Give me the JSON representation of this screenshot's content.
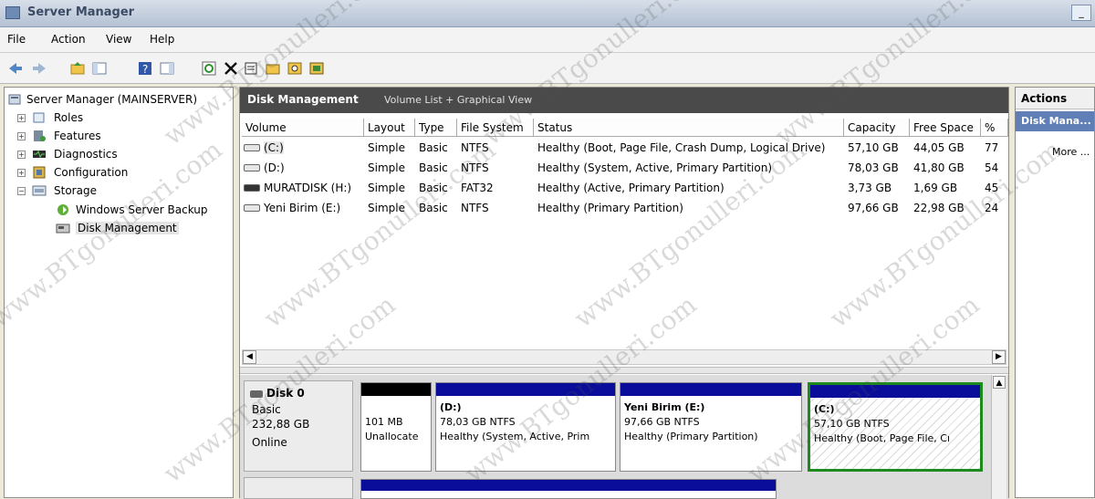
{
  "window": {
    "title": "Server Manager",
    "minimize_label": "_"
  },
  "menu": {
    "items": [
      "File",
      "Action",
      "View",
      "Help"
    ]
  },
  "tree": {
    "root": "Server Manager (MAINSERVER)",
    "items": [
      "Roles",
      "Features",
      "Diagnostics",
      "Configuration",
      "Storage"
    ],
    "storage_children": [
      "Windows Server Backup",
      "Disk Management"
    ]
  },
  "center": {
    "title": "Disk Management",
    "subtitle": "Volume List + Graphical View",
    "columns": [
      "Volume",
      "Layout",
      "Type",
      "File System",
      "Status",
      "Capacity",
      "Free Space",
      "%"
    ],
    "rows": [
      [
        "(C:)",
        "Simple",
        "Basic",
        "NTFS",
        "Healthy (Boot, Page File, Crash Dump, Logical Drive)",
        "57,10 GB",
        "44,05 GB",
        "77"
      ],
      [
        "(D:)",
        "Simple",
        "Basic",
        "NTFS",
        "Healthy (System, Active, Primary Partition)",
        "78,03 GB",
        "41,80 GB",
        "54"
      ],
      [
        "MURATDISK (H:)",
        "Simple",
        "Basic",
        "FAT32",
        "Healthy (Active, Primary Partition)",
        "3,73 GB",
        "1,69 GB",
        "45"
      ],
      [
        "Yeni Birim (E:)",
        "Simple",
        "Basic",
        "NTFS",
        "Healthy (Primary Partition)",
        "97,66 GB",
        "22,98 GB",
        "24"
      ]
    ]
  },
  "disk0": {
    "name": "Disk 0",
    "type": "Basic",
    "size": "232,88 GB",
    "status": "Online",
    "partitions": [
      {
        "label": "",
        "size": "101 MB",
        "detail": "Unallocate"
      },
      {
        "label": "(D:)",
        "size": "78,03 GB NTFS",
        "detail": "Healthy (System, Active, Prim"
      },
      {
        "label": "Yeni Birim  (E:)",
        "size": "97,66 GB NTFS",
        "detail": "Healthy (Primary Partition)"
      },
      {
        "label": "(C:)",
        "size": "57,10 GB NTFS",
        "detail": "Healthy (Boot, Page File, Cı"
      }
    ]
  },
  "actions": {
    "header": "Actions",
    "selected": "Disk Mana...",
    "more": "More ..."
  },
  "watermark": "www.BTgonulleri.com"
}
